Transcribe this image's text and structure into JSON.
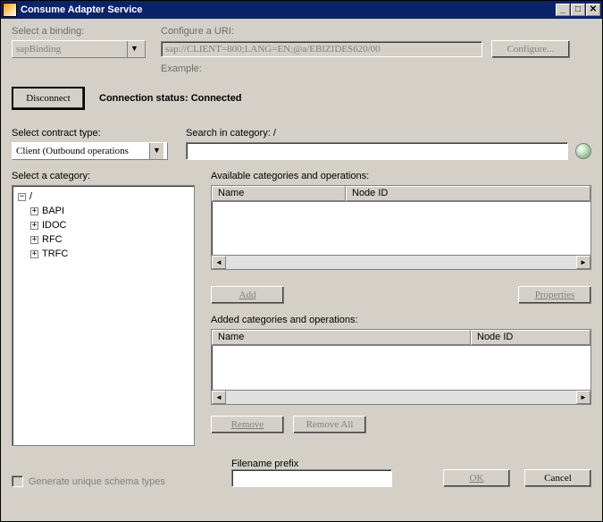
{
  "window": {
    "title": "Consume Adapter Service"
  },
  "labels": {
    "select_binding": "Select a binding:",
    "configure_uri": "Configure a URI:",
    "example": "Example:",
    "connection_status": "Connection status:",
    "connection_value": "Connected",
    "select_contract": "Select contract type:",
    "search_in_category": "Search in category: /",
    "select_category": "Select a category:",
    "available": "Available categories and operations:",
    "added": "Added categories and operations:",
    "filename_prefix": "Filename prefix",
    "generate_unique": "Generate unique schema types"
  },
  "fields": {
    "binding": "sapBinding",
    "uri": "sap://CLIENT=800;LANG=EN;@a/EBIZIDES620/00",
    "contract": "Client (Outbound operations",
    "search": "",
    "filename_prefix": ""
  },
  "buttons": {
    "configure": "Configure...",
    "disconnect": "Disconnect",
    "add": "Add",
    "properties": "Properties",
    "remove": "Remove",
    "remove_all": "Remove All",
    "ok": "OK",
    "cancel": "Cancel"
  },
  "columns": {
    "name": "Name",
    "node_id": "Node ID"
  },
  "tree": {
    "root": "/",
    "items": [
      "BAPI",
      "IDOC",
      "RFC",
      "TRFC"
    ]
  }
}
